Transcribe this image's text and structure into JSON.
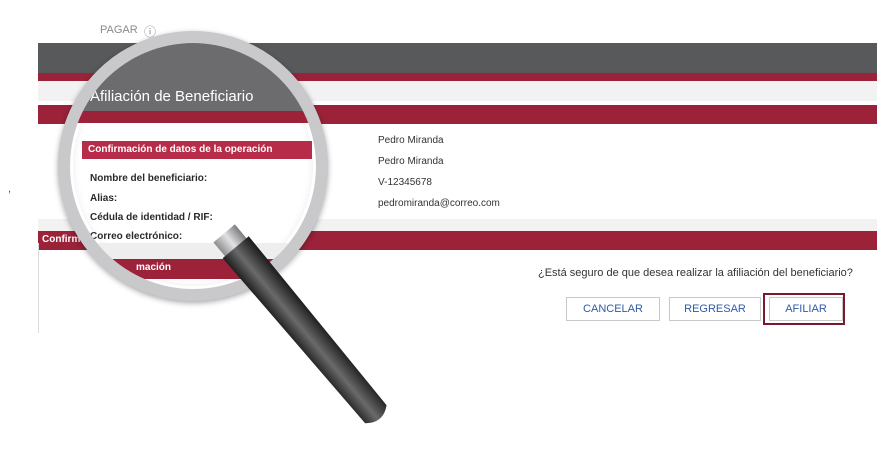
{
  "background": {
    "top_fragment": "PAGAR",
    "top_icon": "info-icon",
    "left_char": ","
  },
  "window": {
    "title": "Afiliación de Beneficiario",
    "sections": {
      "confirm_data": "Confirmación de datos de la operación",
      "confirmation": "Confirmación",
      "confirmation_fragment": "mación",
      "confirmation_left": "Confirm"
    }
  },
  "fields": [
    {
      "label": "Nombre del beneficiario:",
      "value": "Pedro Miranda"
    },
    {
      "label": "Alias:",
      "value": "Pedro Miranda"
    },
    {
      "label": "Cédula de identidad / RIF:",
      "value": "V-12345678"
    },
    {
      "label": "Correo electrónico:",
      "value": "pedromiranda@correo.com"
    }
  ],
  "question": "¿Está seguro de que desea realizar la afiliación del beneficiario?",
  "buttons": {
    "cancel": "CANCELAR",
    "back": "REGRESAR",
    "confirm": "AFILIAR"
  },
  "colors": {
    "topbar": "#58595b",
    "accent": "#9b2239",
    "button_text": "#2e5aa8",
    "highlight_frame": "#7b1830"
  },
  "overlay": {
    "type": "magnifying-glass-icon"
  }
}
